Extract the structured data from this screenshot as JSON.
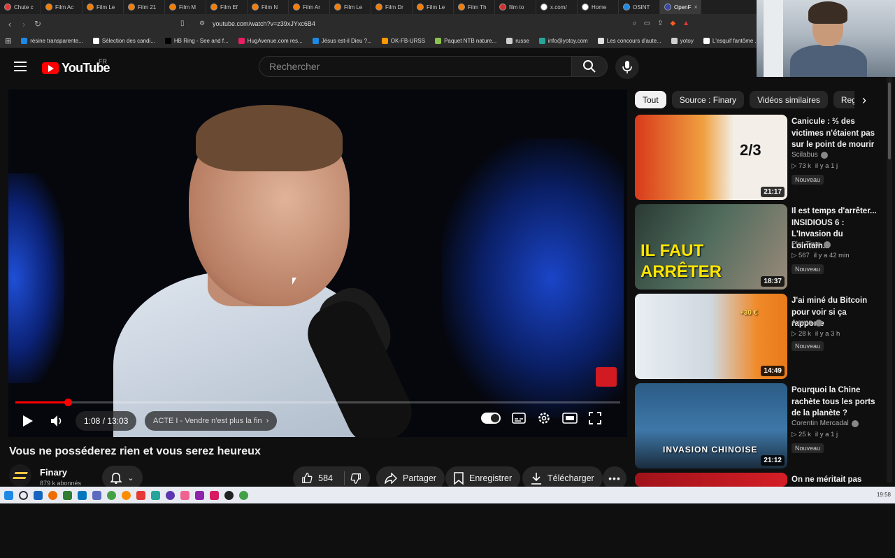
{
  "browser": {
    "tabs": [
      {
        "label": "Chute c",
        "color": "#e53935"
      },
      {
        "label": "Film Ac",
        "color": "#f57c00"
      },
      {
        "label": "Film Le",
        "color": "#f57c00"
      },
      {
        "label": "Film 21",
        "color": "#f57c00"
      },
      {
        "label": "Film M",
        "color": "#f57c00"
      },
      {
        "label": "Film Ef",
        "color": "#f57c00"
      },
      {
        "label": "Film N",
        "color": "#f57c00"
      },
      {
        "label": "Film Ar",
        "color": "#f57c00"
      },
      {
        "label": "Film Le",
        "color": "#f57c00"
      },
      {
        "label": "Film Dr",
        "color": "#f57c00"
      },
      {
        "label": "Film Le",
        "color": "#f57c00"
      },
      {
        "label": "Film Th",
        "color": "#f57c00"
      },
      {
        "label": "film to",
        "color": "#d32f2f"
      },
      {
        "label": "x.com/",
        "color": "#ffffff"
      },
      {
        "label": "Home",
        "color": "#ffffff"
      },
      {
        "label": "OSINT",
        "color": "#1e88e5"
      },
      {
        "label": "OpenF",
        "color": "#3949ab"
      }
    ],
    "url": "youtube.com/watch?v=z39xJYxc6B4",
    "bookmarks": [
      {
        "label": "résine transparente...",
        "color": "#1e88e5"
      },
      {
        "label": "Sélection des candi...",
        "color": "#ffffff"
      },
      {
        "label": "HB Ring - See and f...",
        "color": "#000000"
      },
      {
        "label": "HugAvenue.com res...",
        "color": "#e91e63"
      },
      {
        "label": "Jésus est-il Dieu ?...",
        "color": "#1e88e5"
      },
      {
        "label": "OK-FB-URSS",
        "color": "#ff9800"
      },
      {
        "label": "Paquet NTB nature...",
        "color": "#8bc34a"
      },
      {
        "label": "russe",
        "color": "#cfcfcf"
      },
      {
        "label": "info@yotoy.com",
        "color": "#26a69a"
      },
      {
        "label": "Les concours d'aute...",
        "color": "#e0e0e0"
      },
      {
        "label": "yotoy",
        "color": "#cfcfcf"
      },
      {
        "label": "L'esquif fantôme ...",
        "color": "#ffffff"
      }
    ]
  },
  "youtube": {
    "logo_text": "YouTube",
    "region": "FR",
    "search_placeholder": "Rechercher",
    "player": {
      "time": "1:08 / 13:03",
      "chapter": "ACTE I - Vendre n'est plus la fin",
      "progress_fraction": 0.087
    },
    "video_title": "Vous ne posséderez rien et vous serez heureux",
    "channel": {
      "name": "Finary",
      "subscribers": "879 k abonnés"
    },
    "actions": {
      "likes": "584",
      "share": "Partager",
      "save": "Enregistrer",
      "download": "Télécharger"
    },
    "chips": [
      "Tout",
      "Source : Finary",
      "Vidéos similaires",
      "Reg"
    ],
    "recommendations": [
      {
        "title": "Canicule : ⅔ des victimes n'étaient pas sur le point de mourir",
        "channel": "Scilabus",
        "views": "▷ 73 k",
        "age": "il y a 1 j",
        "badge": "Nouveau",
        "duration": "21:17",
        "thumb_text": "2/3"
      },
      {
        "title": "Il est temps d'arrêter... INSIDIOUS 6 : L'Invasion du Lointain...",
        "channel": "Plot Time",
        "views": "▷ 567",
        "age": "il y a 42 min",
        "badge": "Nouveau",
        "duration": "18:37",
        "thumb_text": "IL FAUT ARRÊTER"
      },
      {
        "title": "J'ai miné du Bitcoin pour voir si ça rapporte",
        "channel": "Aywen",
        "views": "▷ 28 k",
        "age": "il y a 3 h",
        "badge": "Nouveau",
        "duration": "14:49",
        "thumb_text": "+30 €"
      },
      {
        "title": "Pourquoi la Chine rachète tous les ports de la planète ?",
        "channel": "Corentin Mercadal",
        "views": "▷ 25 k",
        "age": "il y a 1 j",
        "badge": "Nouveau",
        "duration": "21:12",
        "thumb_text": "INVASION CHINOISE"
      },
      {
        "title": "On ne méritait pas",
        "channel": "",
        "views": "",
        "age": "",
        "badge": "",
        "duration": "",
        "thumb_text": ""
      }
    ]
  },
  "taskbar": {
    "clock": "19:58"
  }
}
